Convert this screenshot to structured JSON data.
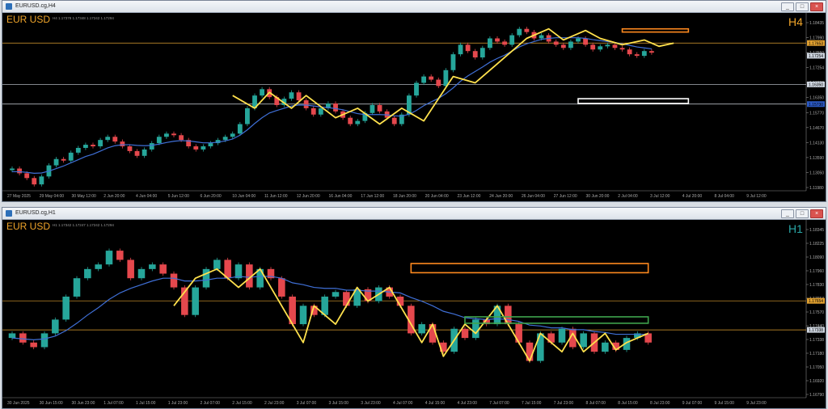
{
  "windows": [
    {
      "title": "EURUSD.cg,H4",
      "symbol_label": "EUR USD",
      "timeframe_label": "H4",
      "ohlc_info": "H4 1.17378 1.17348 1.17242 1.17294",
      "buttons": [
        "_",
        "□",
        "×"
      ],
      "colors": {
        "bull": "#26a69a",
        "bear": "#e5484d",
        "ma": "#3f6fd6",
        "zigzag": "#ffe14d",
        "hline": "#e0a030",
        "background": "#000000"
      },
      "chart_data": {
        "type": "candlestick",
        "ylim": [
          1.13,
          1.185
        ],
        "y_ticks": [
          "1.18435",
          "1.17990",
          "1.17550",
          "1.17254",
          "1.16830",
          "1.16350",
          "1.15770",
          "1.14670",
          "1.14130",
          "1.13590",
          "1.13050",
          "1.11980"
        ],
        "x_ticks": [
          "27 May 2025",
          "29 May 04:00",
          "30 May 12:00",
          "2 Jun 20:00",
          "4 Jun 04:00",
          "5 Jun 12:00",
          "6 Jun 20:00",
          "10 Jun 04:00",
          "11 Jun 12:00",
          "12 Jun 20:00",
          "16 Jun 04:00",
          "17 Jun 12:00",
          "18 Jun 20:00",
          "20 Jun 04:00",
          "23 Jun 12:00",
          "24 Jun 20:00",
          "26 Jun 04:00",
          "27 Jun 12:00",
          "30 Jun 20:00",
          "2 Jul 04:00",
          "3 Jul 12:00",
          "4 Jul 20:00",
          "8 Jul 04:00",
          "9 Jul 12:00"
        ],
        "close": [
          1.137,
          1.1355,
          1.134,
          1.132,
          1.1345,
          1.138,
          1.14,
          1.1395,
          1.142,
          1.1435,
          1.1445,
          1.144,
          1.146,
          1.147,
          1.1455,
          1.144,
          1.1425,
          1.141,
          1.143,
          1.145,
          1.147,
          1.148,
          1.1475,
          1.146,
          1.144,
          1.143,
          1.144,
          1.145,
          1.146,
          1.147,
          1.148,
          1.151,
          1.156,
          1.16,
          1.162,
          1.1595,
          1.157,
          1.159,
          1.161,
          1.1585,
          1.156,
          1.154,
          1.156,
          1.1575,
          1.155,
          1.153,
          1.151,
          1.152,
          1.1545,
          1.157,
          1.155,
          1.153,
          1.151,
          1.154,
          1.16,
          1.164,
          1.166,
          1.165,
          1.163,
          1.168,
          1.173,
          1.176,
          1.174,
          1.172,
          1.175,
          1.178,
          1.177,
          1.176,
          1.179,
          1.181,
          1.18,
          1.178,
          1.179,
          1.177,
          1.176,
          1.175,
          1.177,
          1.178,
          1.176,
          1.1745,
          1.1755,
          1.176,
          1.175,
          1.1745,
          1.173,
          1.1725,
          1.174,
          1.1735
        ],
        "ma": [
          1.136,
          1.136,
          1.1358,
          1.1355,
          1.1356,
          1.1362,
          1.137,
          1.1378,
          1.1388,
          1.1398,
          1.1408,
          1.1415,
          1.1425,
          1.1435,
          1.1442,
          1.1445,
          1.1445,
          1.1443,
          1.1442,
          1.1443,
          1.1447,
          1.1452,
          1.1456,
          1.1458,
          1.1457,
          1.1454,
          1.1451,
          1.1451,
          1.1453,
          1.1457,
          1.1463,
          1.1475,
          1.1492,
          1.1512,
          1.153,
          1.1545,
          1.1553,
          1.156,
          1.1567,
          1.157,
          1.157,
          1.1567,
          1.1564,
          1.1562,
          1.1559,
          1.1555,
          1.1549,
          1.1543,
          1.154,
          1.154,
          1.154,
          1.1539,
          1.1536,
          1.1535,
          1.1541,
          1.1553,
          1.1568,
          1.158,
          1.1591,
          1.1606,
          1.1624,
          1.1645,
          1.1662,
          1.1676,
          1.169,
          1.1705,
          1.1717,
          1.1727,
          1.174,
          1.1753,
          1.1763,
          1.177,
          1.1777,
          1.178,
          1.1782,
          1.1782,
          1.1782,
          1.1782,
          1.178,
          1.1776,
          1.1773,
          1.177,
          1.1767,
          1.1763,
          1.1758,
          1.1753,
          1.175,
          1.1747
        ],
        "zigzag": [
          [
            30,
            1.16
          ],
          [
            33,
            1.156
          ],
          [
            35,
            1.161
          ],
          [
            38,
            1.156
          ],
          [
            40,
            1.16
          ],
          [
            44,
            1.153
          ],
          [
            47,
            1.156
          ],
          [
            50,
            1.151
          ],
          [
            53,
            1.156
          ],
          [
            56,
            1.152
          ],
          [
            60,
            1.166
          ],
          [
            63,
            1.164
          ],
          [
            66,
            1.17
          ],
          [
            68,
            1.174
          ],
          [
            70,
            1.178
          ],
          [
            73,
            1.181
          ],
          [
            75,
            1.1775
          ],
          [
            78,
            1.1805
          ],
          [
            80,
            1.178
          ],
          [
            83,
            1.176
          ],
          [
            86,
            1.1775
          ],
          [
            88,
            1.1755
          ],
          [
            90,
            1.1765
          ]
        ],
        "hlines": [
          1.17653,
          1.1635,
          1.1573
        ],
        "zones": [
          {
            "color": "#ff8a1f",
            "y_top": 1.181,
            "y_bottom": 1.18,
            "start": 83,
            "end": 92
          },
          {
            "color": "#ffffff",
            "y_top": 1.159,
            "y_bottom": 1.1575,
            "start": 77,
            "end": 92
          }
        ],
        "price_labels": [
          "1.17653",
          "1.17254",
          "1.16350",
          "1.15730"
        ]
      }
    },
    {
      "title": "EURUSD.cg,H1",
      "symbol_label": "EUR USD",
      "timeframe_label": "H1",
      "ohlc_info": "H1 1.17342 1.17247 1.17242 1.17294",
      "buttons": [
        "_",
        "□",
        "×"
      ],
      "colors": {
        "bull": "#26a69a",
        "bear": "#e5484d",
        "ma": "#3f6fd6",
        "zigzag": "#ffe14d",
        "hline": "#e0a030",
        "background": "#000000"
      },
      "chart_data": {
        "type": "candlestick",
        "ylim": [
          1.166,
          1.185
        ],
        "y_ticks": [
          "1.18345",
          "1.18225",
          "1.18090",
          "1.17960",
          "1.17830",
          "1.17654",
          "1.17570",
          "1.17440",
          "1.17338",
          "1.17180",
          "1.17050",
          "1.16920",
          "1.16790"
        ],
        "x_ticks": [
          "30 Jun 2025",
          "30 Jun 15:00",
          "30 Jun 23:00",
          "1 Jul 07:00",
          "1 Jul 15:00",
          "1 Jul 23:00",
          "2 Jul 07:00",
          "2 Jul 15:00",
          "2 Jul 23:00",
          "3 Jul 07:00",
          "3 Jul 15:00",
          "3 Jul 23:00",
          "4 Jul 07:00",
          "4 Jul 15:00",
          "4 Jul 23:00",
          "7 Jul 07:00",
          "7 Jul 15:00",
          "7 Jul 23:00",
          "8 Jul 07:00",
          "8 Jul 15:00",
          "8 Jul 23:00",
          "9 Jul 07:00",
          "9 Jul 15:00",
          "9 Jul 23:00"
        ],
        "close": [
          1.173,
          1.172,
          1.1715,
          1.173,
          1.1745,
          1.177,
          1.179,
          1.18,
          1.1805,
          1.182,
          1.181,
          1.179,
          1.18,
          1.1805,
          1.1795,
          1.178,
          1.175,
          1.178,
          1.18,
          1.181,
          1.179,
          1.1805,
          1.178,
          1.18,
          1.179,
          1.177,
          1.174,
          1.176,
          1.175,
          1.177,
          1.1775,
          1.176,
          1.1778,
          1.1765,
          1.178,
          1.177,
          1.176,
          1.173,
          1.174,
          1.172,
          1.171,
          1.1735,
          1.1725,
          1.1745,
          1.174,
          1.176,
          1.174,
          1.172,
          1.17,
          1.173,
          1.172,
          1.1735,
          1.1715,
          1.173,
          1.171,
          1.172,
          1.1712,
          1.1725,
          1.173,
          1.172
        ],
        "ma": [
          1.1725,
          1.1724,
          1.1723,
          1.1724,
          1.1727,
          1.1733,
          1.1741,
          1.175,
          1.1758,
          1.1767,
          1.1774,
          1.1779,
          1.1783,
          1.1787,
          1.179,
          1.179,
          1.1787,
          1.1787,
          1.1788,
          1.179,
          1.179,
          1.1792,
          1.1791,
          1.1792,
          1.1792,
          1.179,
          1.1785,
          1.1783,
          1.178,
          1.1779,
          1.1779,
          1.1777,
          1.1777,
          1.1776,
          1.1776,
          1.1775,
          1.1774,
          1.1769,
          1.1765,
          1.176,
          1.1754,
          1.1751,
          1.1747,
          1.1746,
          1.1745,
          1.1746,
          1.1745,
          1.1743,
          1.1739,
          1.1738,
          1.1736,
          1.1736,
          1.1734,
          1.1734,
          1.1732,
          1.1731,
          1.1729,
          1.1729,
          1.1729,
          1.1729
        ],
        "zigzag": [
          [
            15,
            1.176
          ],
          [
            17,
            1.179
          ],
          [
            19,
            1.18
          ],
          [
            21,
            1.178
          ],
          [
            23,
            1.18
          ],
          [
            25,
            1.176
          ],
          [
            27,
            1.172
          ],
          [
            28,
            1.176
          ],
          [
            30,
            1.174
          ],
          [
            32,
            1.178
          ],
          [
            33,
            1.1765
          ],
          [
            35,
            1.178
          ],
          [
            36,
            1.176
          ],
          [
            38,
            1.172
          ],
          [
            39,
            1.174
          ],
          [
            40,
            1.1705
          ],
          [
            42,
            1.174
          ],
          [
            43,
            1.173
          ],
          [
            45,
            1.176
          ],
          [
            46,
            1.174
          ],
          [
            47,
            1.172
          ],
          [
            48,
            1.17
          ],
          [
            49,
            1.173
          ],
          [
            51,
            1.171
          ],
          [
            52,
            1.173
          ],
          [
            53,
            1.171
          ],
          [
            55,
            1.173
          ],
          [
            56,
            1.1712
          ],
          [
            57,
            1.172
          ],
          [
            59,
            1.173
          ]
        ],
        "hlines": [
          1.17654,
          1.17338
        ],
        "zones": [
          {
            "color": "#ff8a1f",
            "y_top": 1.1806,
            "y_bottom": 1.1796,
            "start": 37,
            "end": 59
          },
          {
            "color": "#3fa34d",
            "y_top": 1.1748,
            "y_bottom": 1.1741,
            "start": 42,
            "end": 59
          }
        ],
        "price_labels": [
          "1.17654",
          "1.17338"
        ]
      }
    }
  ]
}
